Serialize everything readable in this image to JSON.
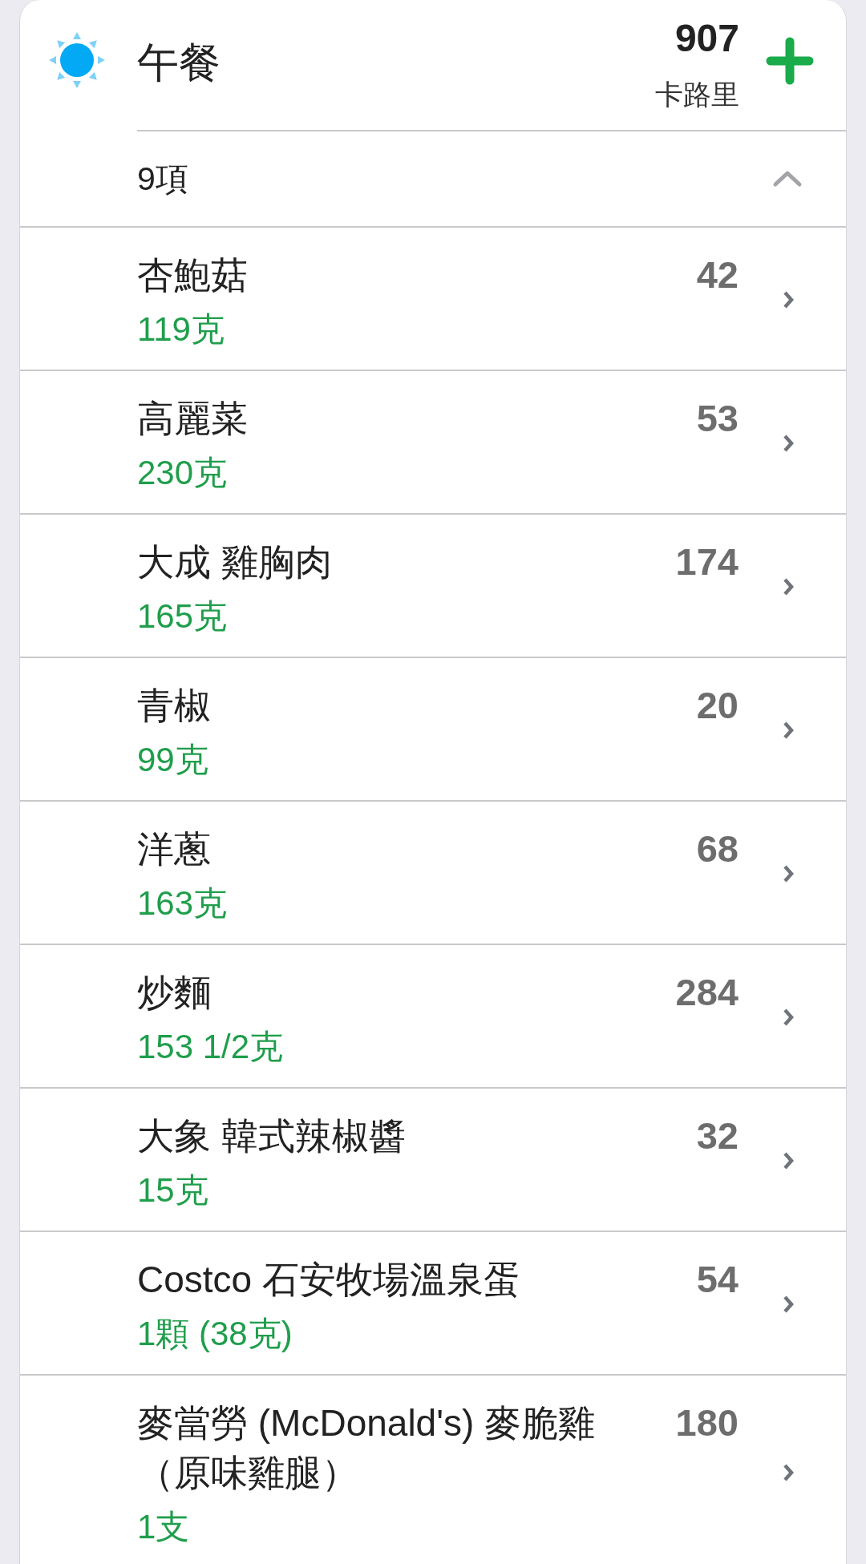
{
  "meal": {
    "title": "午餐",
    "calories": "907",
    "calories_unit": "卡路里",
    "item_count": "9項",
    "expanded": true
  },
  "items": [
    {
      "name": "杏鮑菇",
      "amount": "119克",
      "calories": "42"
    },
    {
      "name": "高麗菜",
      "amount": "230克",
      "calories": "53"
    },
    {
      "name": "大成 雞胸肉",
      "amount": "165克",
      "calories": "174"
    },
    {
      "name": "青椒",
      "amount": "99克",
      "calories": "20"
    },
    {
      "name": "洋蔥",
      "amount": "163克",
      "calories": "68"
    },
    {
      "name": "炒麵",
      "amount": "153 1/2克",
      "calories": "284"
    },
    {
      "name": "大象 韓式辣椒醬",
      "amount": "15克",
      "calories": "32"
    },
    {
      "name": "Costco 石安牧場溫泉蛋",
      "amount": "1顆 (38克)",
      "calories": "54"
    },
    {
      "name": "麥當勞 (McDonald's) 麥脆雞（原味雞腿）",
      "amount": "1支",
      "calories": "180"
    }
  ]
}
